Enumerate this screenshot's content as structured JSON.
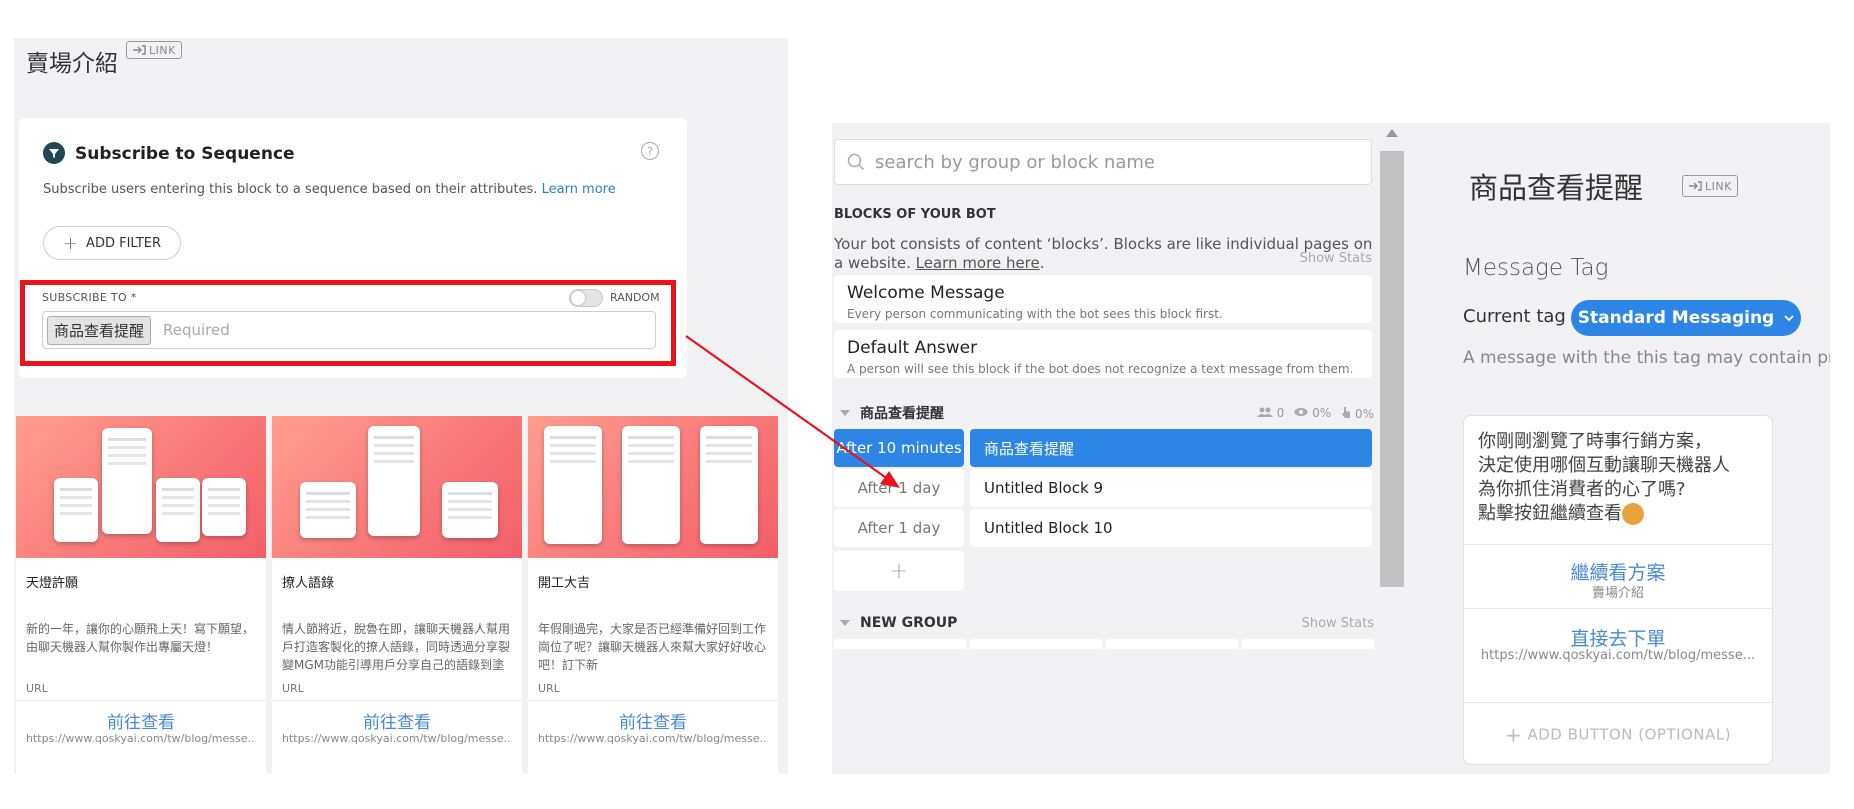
{
  "left": {
    "title": "賣場介紹",
    "link_label": "LINK",
    "subscribe": {
      "title": "Subscribe to Sequence",
      "help": "?",
      "description": "Subscribe users entering this block to a sequence based on their attributes.",
      "learn_more": "Learn more",
      "add_filter": "ADD FILTER",
      "subscribe_to_label": "SUBSCRIBE TO *",
      "random_label": "RANDOM",
      "tag": "商品查看提醒",
      "placeholder": "Required"
    },
    "templates": [
      {
        "title": "天燈許願",
        "description": "新的一年，讓你的心願飛上天！寫下願望，由聊天機器人幫你製作出專屬天燈！",
        "url_label": "URL",
        "button": "前往查看",
        "button_url": "https://www.qoskyai.com/tw/blog/messe..."
      },
      {
        "title": "撩人語錄",
        "description": "情人節將近，脫魯在即，讓聊天機器人幫用戶打造客製化的撩人語錄，同時透過分享裂變MGM功能引導用戶分享自己的語錄到塗鴉",
        "url_label": "URL",
        "button": "前往查看",
        "button_url": "https://www.qoskyai.com/tw/blog/messe..."
      },
      {
        "title": "開工大吉",
        "description": "年假剛過完，大家是否已經準備好回到工作崗位了呢？讓聊天機器人來幫大家好好收心吧！訂下新",
        "url_label": "URL",
        "button": "前往查看",
        "button_url": "https://www.qoskyai.com/tw/blog/messe..."
      }
    ]
  },
  "middle": {
    "search_placeholder": "search by group or block name",
    "heading": "BLOCKS OF YOUR BOT",
    "description": "Your bot consists of content ‘blocks’. Blocks are like individual pages on a website.",
    "learn_more": "Learn more here",
    "show_stats": "Show Stats",
    "blocks": [
      {
        "name": "Welcome Message",
        "subtitle": "Every person communicating with the bot sees this block first."
      },
      {
        "name": "Default Answer",
        "subtitle": "A person will see this block if the bot does not recognize a text message from them."
      }
    ],
    "group": {
      "name": "商品查看提醒",
      "users": "0",
      "seen": "0%",
      "clicked": "0%"
    },
    "sequence": [
      {
        "delay": "After 10 minutes",
        "block": "商品查看提醒",
        "active": true
      },
      {
        "delay": "After 1 day",
        "block": "Untitled Block 9",
        "active": false
      },
      {
        "delay": "After 1 day",
        "block": "Untitled Block 10",
        "active": false
      }
    ],
    "add_block": "+",
    "new_group": {
      "name": "NEW GROUP",
      "show_stats": "Show Stats"
    }
  },
  "right": {
    "title": "商品查看提醒",
    "link_label": "LINK",
    "message_tag_heading": "Message Tag",
    "current_tag_label": "Current tag",
    "current_tag": "Standard Messaging",
    "tag_description": "A message with the this tag may contain prom",
    "message_lines": [
      "你剛剛瀏覽了時事行銷方案，",
      "決定使用哪個互動讓聊天機器人",
      "為你抓住消費者的心了嗎?",
      "點擊按鈕繼續查看"
    ],
    "buttons": [
      {
        "title": "繼續看方案",
        "subtitle": "賣場介紹"
      },
      {
        "title": "直接去下單",
        "subtitle": "https://www.qoskyai.com/tw/blog/messe..."
      }
    ],
    "add_button": "ADD BUTTON (OPTIONAL)"
  },
  "colors": {
    "accent_blue": "#2d86e6",
    "highlight_red": "#e8141b",
    "panel_bg": "#f2f2f4",
    "template_gradient": "#f35e68"
  }
}
